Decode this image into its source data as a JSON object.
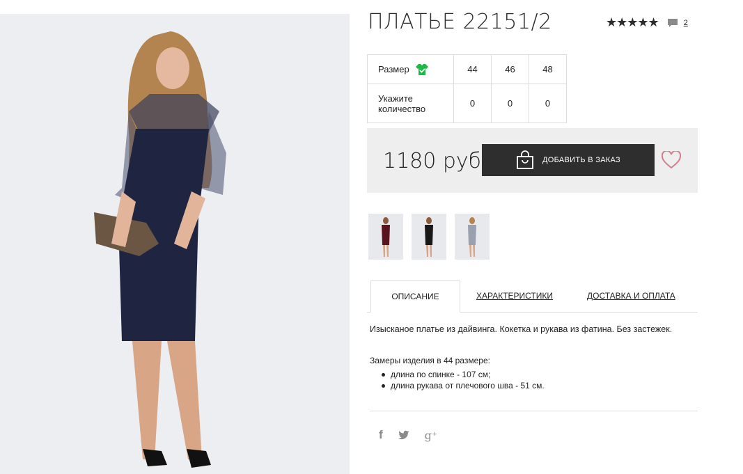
{
  "product": {
    "title": "ПЛАТЬЕ 22151/2",
    "rating_stars": "★★★★★",
    "review_count": "2",
    "price": "1180 руб"
  },
  "size_table": {
    "size_label": "Размер",
    "qty_label_line1": "Укажите",
    "qty_label_line2": "количество",
    "sizes": [
      "44",
      "46",
      "48"
    ],
    "quantities": [
      "0",
      "0",
      "0"
    ]
  },
  "buttons": {
    "add_to_order": "ДОБАВИТЬ В ЗАКАЗ"
  },
  "tabs": {
    "description": "ОПИСАНИЕ",
    "characteristics": "ХАРАКТЕРИСТИКИ",
    "delivery": "ДОСТАВКА И ОПЛАТА"
  },
  "description": {
    "text": "Изысканое платье из дайвинга. Кокетка и рукава из фатина. Без застежек.",
    "measures_title": "Замеры изделия в 44 размере:",
    "measures": [
      "длина по спинке - 107 см;",
      "длина рукава от плечового шва - 51 см."
    ]
  },
  "social": {
    "facebook": "f",
    "google_plus": "g⁺"
  },
  "colors": {
    "accent_green": "#1fb84a",
    "button_dark": "#2e2e2e",
    "heart": "#d97a8c"
  }
}
